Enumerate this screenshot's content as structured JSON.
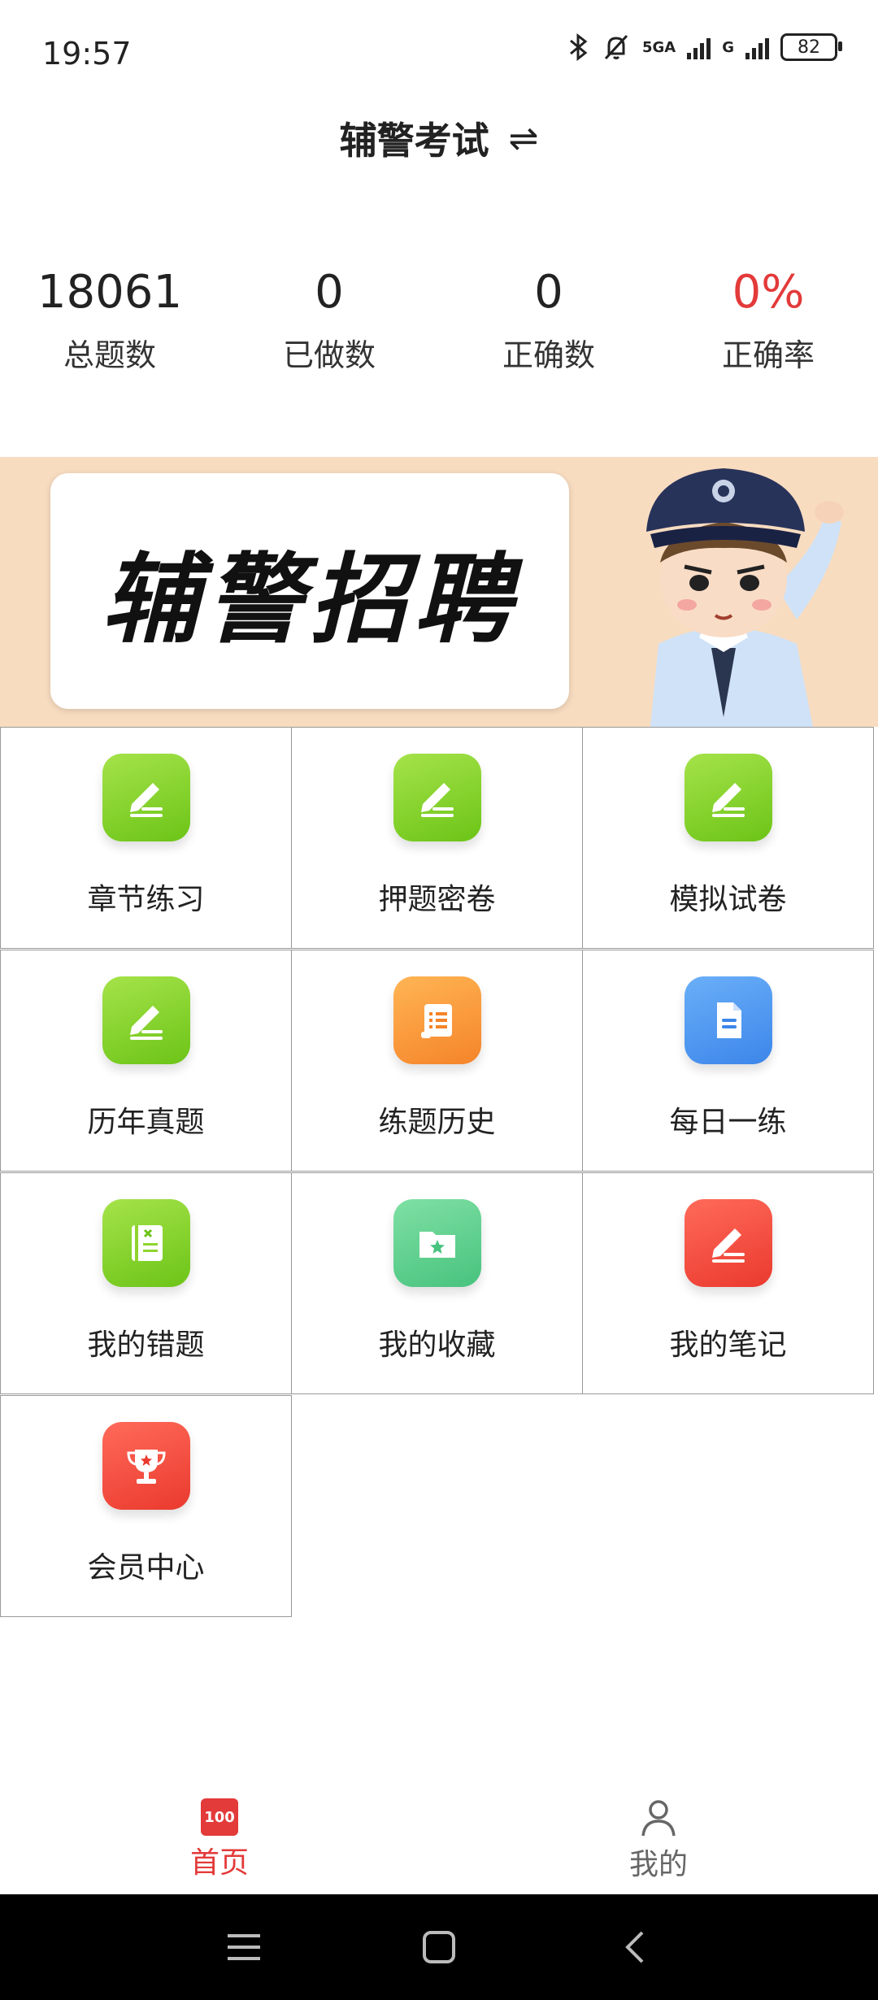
{
  "status_bar": {
    "time": "19:57",
    "network_1": "5GA",
    "network_2": "G",
    "battery": "82"
  },
  "header": {
    "title": "辅警考试",
    "swap_symbol": "⇌"
  },
  "stats": [
    {
      "value": "18061",
      "label": "总题数"
    },
    {
      "value": "0",
      "label": "已做数"
    },
    {
      "value": "0",
      "label": "正确数"
    },
    {
      "value": "0%",
      "label": "正确率",
      "color": "#e33a3a"
    }
  ],
  "banner": {
    "text": "辅警招聘"
  },
  "menu": [
    {
      "label": "章节练习",
      "icon": "pencil-icon",
      "color": "green"
    },
    {
      "label": "押题密卷",
      "icon": "pencil-icon",
      "color": "green"
    },
    {
      "label": "模拟试卷",
      "icon": "pencil-icon",
      "color": "green"
    },
    {
      "label": "历年真题",
      "icon": "pencil-icon",
      "color": "green"
    },
    {
      "label": "练题历史",
      "icon": "scroll-icon",
      "color": "orange"
    },
    {
      "label": "每日一练",
      "icon": "document-icon",
      "color": "blue"
    },
    {
      "label": "我的错题",
      "icon": "notebook-icon",
      "color": "green"
    },
    {
      "label": "我的收藏",
      "icon": "star-folder-icon",
      "color": "teal"
    },
    {
      "label": "我的笔记",
      "icon": "pencil-icon",
      "color": "red"
    },
    {
      "label": "会员中心",
      "icon": "trophy-icon",
      "color": "red"
    }
  ],
  "bottom_nav": {
    "home_label": "首页",
    "home_badge": "100",
    "mine_label": "我的",
    "active_color": "#e33a3a"
  }
}
